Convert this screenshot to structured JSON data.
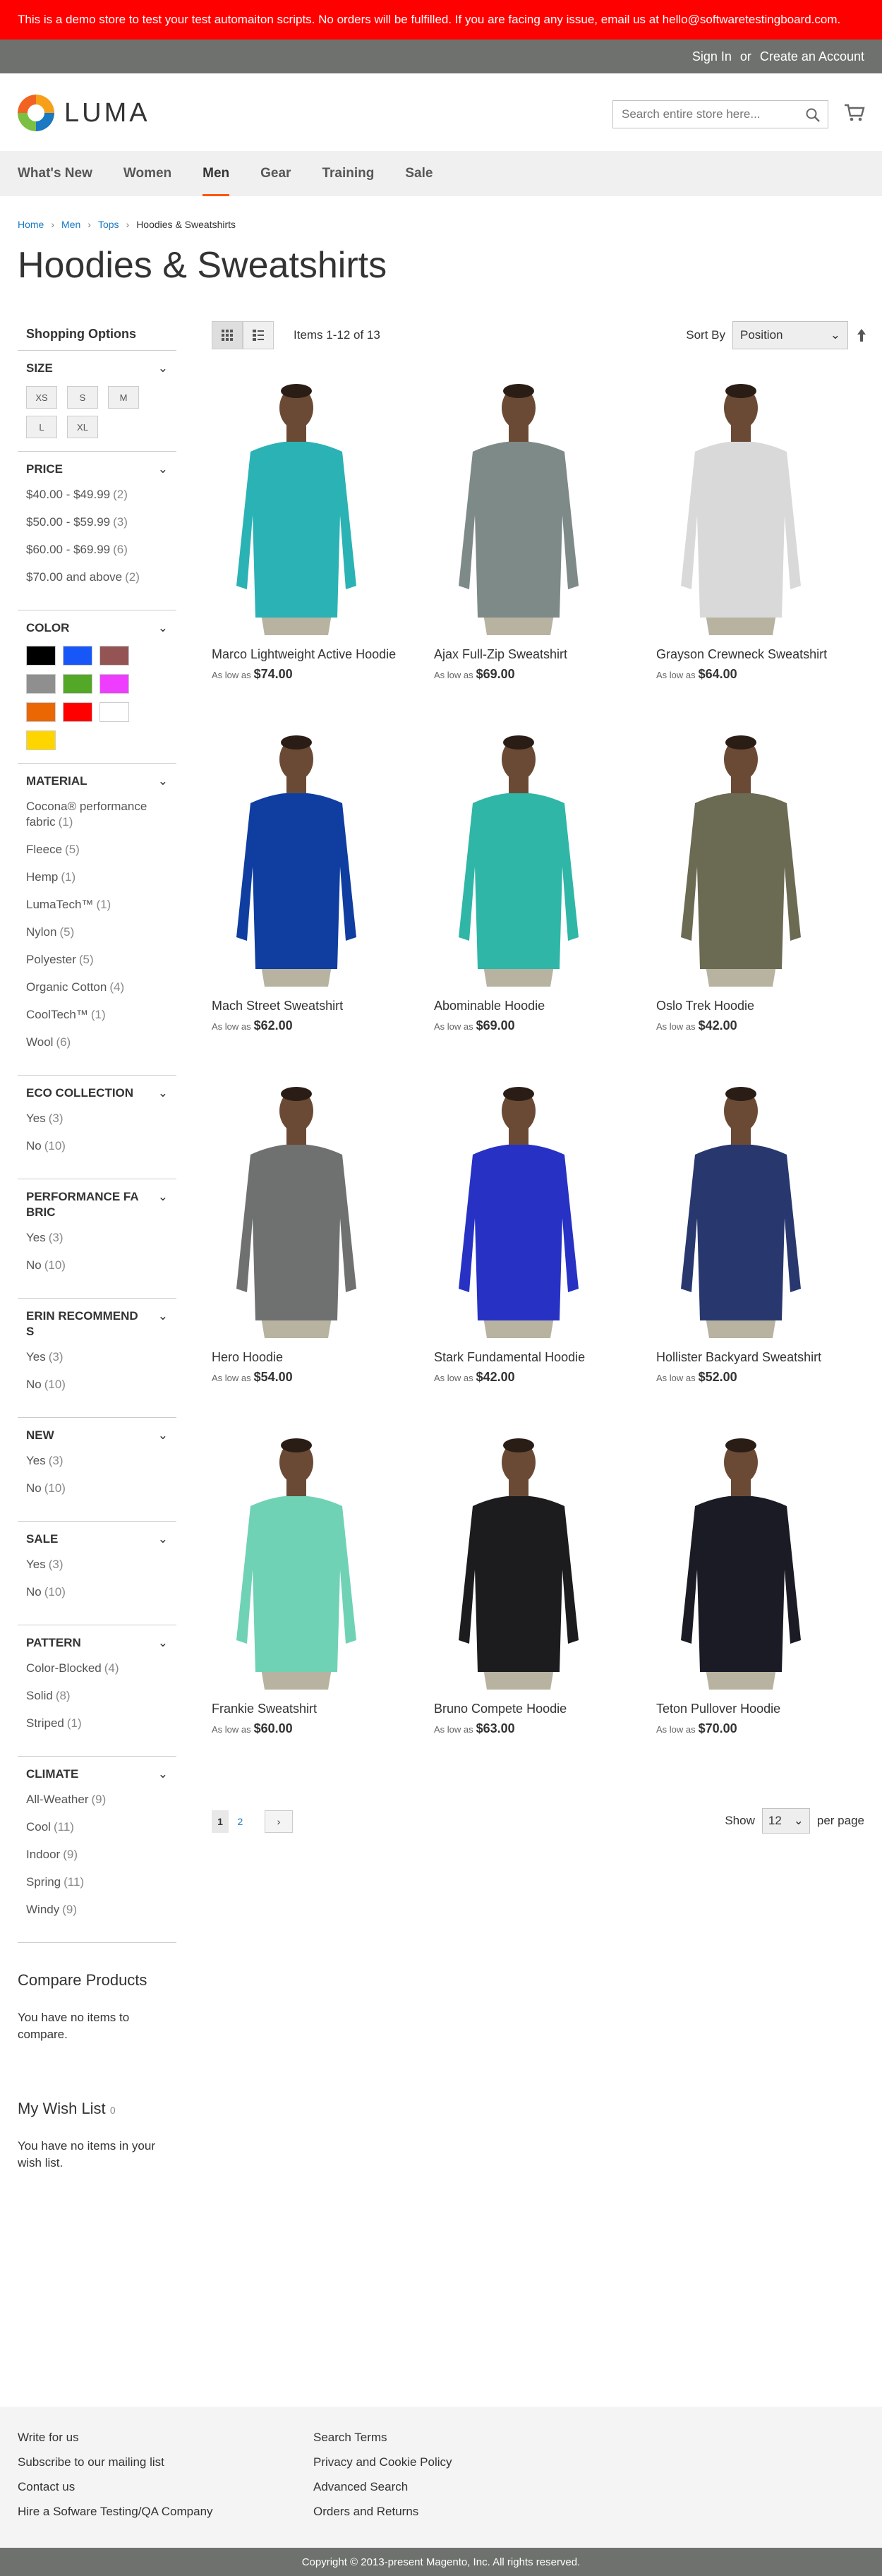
{
  "demo_notice": "This is a demo store to test your test automaiton scripts. No orders will be fulfilled. If you are facing any issue, email us at hello@softwaretestingboard.com.",
  "header": {
    "sign_in": "Sign In",
    "or": "or",
    "create_account": "Create an Account",
    "logo_text": "LUMA",
    "search_placeholder": "Search entire store here..."
  },
  "nav": [
    "What's New",
    "Women",
    "Men",
    "Gear",
    "Training",
    "Sale"
  ],
  "breadcrumb": {
    "home": "Home",
    "men": "Men",
    "tops": "Tops",
    "current": "Hoodies & Sweatshirts"
  },
  "page_title": "Hoodies & Sweatshirts",
  "sidebar": {
    "shopping_options": "Shopping Options",
    "size_title": "Size",
    "sizes": [
      "XS",
      "S",
      "M",
      "L",
      "XL"
    ],
    "price_title": "Price",
    "prices": [
      {
        "label": "$40.00 - $49.99",
        "count": "(2)"
      },
      {
        "label": "$50.00 - $59.99",
        "count": "(3)"
      },
      {
        "label": "$60.00 - $69.99",
        "count": "(6)"
      },
      {
        "label": "$70.00 and above",
        "count": "(2)"
      }
    ],
    "color_title": "Color",
    "colors": [
      "#000000",
      "#1857f7",
      "#945454",
      "#8f8f8f",
      "#53a828",
      "#ef3dff",
      "#eb6703",
      "#ff0000",
      "#ffffff",
      "#ffd500"
    ],
    "material_title": "Material",
    "materials": [
      {
        "label": "Cocona® performance fabric",
        "count": "(1)"
      },
      {
        "label": "Fleece",
        "count": "(5)"
      },
      {
        "label": "Hemp",
        "count": "(1)"
      },
      {
        "label": "LumaTech™",
        "count": "(1)"
      },
      {
        "label": "Nylon",
        "count": "(5)"
      },
      {
        "label": "Polyester",
        "count": "(5)"
      },
      {
        "label": "Organic Cotton",
        "count": "(4)"
      },
      {
        "label": "CoolTech™",
        "count": "(1)"
      },
      {
        "label": "Wool",
        "count": "(6)"
      }
    ],
    "eco_title": "Eco Collection",
    "eco": [
      {
        "label": "Yes",
        "count": "(3)"
      },
      {
        "label": "No",
        "count": "(10)"
      }
    ],
    "perf_title": "Performance Fa bric",
    "perf": [
      {
        "label": "Yes",
        "count": "(3)"
      },
      {
        "label": "No",
        "count": "(10)"
      }
    ],
    "erin_title": "Erin Recommend s",
    "erin": [
      {
        "label": "Yes",
        "count": "(3)"
      },
      {
        "label": "No",
        "count": "(10)"
      }
    ],
    "new_title": "New",
    "new": [
      {
        "label": "Yes",
        "count": "(3)"
      },
      {
        "label": "No",
        "count": "(10)"
      }
    ],
    "sale_title": "Sale",
    "sale": [
      {
        "label": "Yes",
        "count": "(3)"
      },
      {
        "label": "No",
        "count": "(10)"
      }
    ],
    "pattern_title": "Pattern",
    "patterns": [
      {
        "label": "Color-Blocked",
        "count": "(4)"
      },
      {
        "label": "Solid",
        "count": "(8)"
      },
      {
        "label": "Striped",
        "count": "(1)"
      }
    ],
    "climate_title": "Climate",
    "climate": [
      {
        "label": "All-Weather",
        "count": "(9)"
      },
      {
        "label": "Cool",
        "count": "(11)"
      },
      {
        "label": "Indoor",
        "count": "(9)"
      },
      {
        "label": "Spring",
        "count": "(11)"
      },
      {
        "label": "Windy",
        "count": "(9)"
      }
    ],
    "compare_title": "Compare Products",
    "compare_text": "You have no items to compare.",
    "wishlist_title": "My Wish List",
    "wishlist_count": "0",
    "wishlist_text": "You have no items in your wish list."
  },
  "toolbar": {
    "amount": "Items 1-12 of 13",
    "sort_label": "Sort By",
    "sort_value": "Position"
  },
  "products": [
    {
      "name": "Marco Lightweight Active Hoodie",
      "as_low_as": "As low as",
      "price": "$74.00",
      "color": "#2bb2b4"
    },
    {
      "name": "Ajax Full-Zip Sweatshirt",
      "as_low_as": "As low as",
      "price": "$69.00",
      "color": "#7e8a88"
    },
    {
      "name": "Grayson Crewneck Sweatshirt",
      "as_low_as": "As low as",
      "price": "$64.00",
      "color": "#d9d9d9"
    },
    {
      "name": "Mach Street Sweatshirt",
      "as_low_as": "As low as",
      "price": "$62.00",
      "color": "#0f3da0"
    },
    {
      "name": "Abominable Hoodie",
      "as_low_as": "As low as",
      "price": "$69.00",
      "color": "#2fb6a6"
    },
    {
      "name": "Oslo Trek Hoodie",
      "as_low_as": "As low as",
      "price": "$42.00",
      "color": "#6b6a52"
    },
    {
      "name": "Hero Hoodie",
      "as_low_as": "As low as",
      "price": "$54.00",
      "color": "#6f7070"
    },
    {
      "name": "Stark Fundamental Hoodie",
      "as_low_as": "As low as",
      "price": "$42.00",
      "color": "#2731c4"
    },
    {
      "name": "Hollister Backyard Sweatshirt",
      "as_low_as": "As low as",
      "price": "$52.00",
      "color": "#28386e"
    },
    {
      "name": "Frankie Sweatshirt",
      "as_low_as": "As low as",
      "price": "$60.00",
      "color": "#6fd2b4"
    },
    {
      "name": "Bruno Compete Hoodie",
      "as_low_as": "As low as",
      "price": "$63.00",
      "color": "#1c1c1f"
    },
    {
      "name": "Teton Pullover Hoodie",
      "as_low_as": "As low as",
      "price": "$70.00",
      "color": "#1a1b24"
    }
  ],
  "pager": {
    "page1": "1",
    "page2": "2",
    "show": "Show",
    "limit": "12",
    "per_page": "per page"
  },
  "footer": {
    "col1": [
      "Write for us",
      "Subscribe to our mailing list",
      "Contact us",
      "Hire a Sofware Testing/QA Company"
    ],
    "col2": [
      "Search Terms",
      "Privacy and Cookie Policy",
      "Advanced Search",
      "Orders and Returns"
    ],
    "copyright": "Copyright © 2013-present Magento, Inc. All rights reserved."
  }
}
